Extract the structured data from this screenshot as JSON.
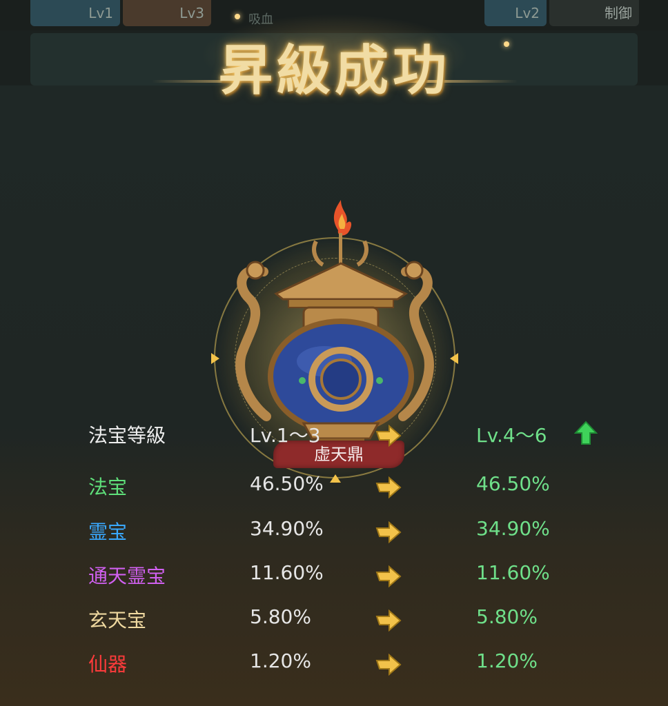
{
  "background_tabs": [
    "Lv1",
    "Lv3",
    "Lv2",
    "制御"
  ],
  "background_fragment": "吸血",
  "banner": {
    "title": "昇級成功"
  },
  "artifact": {
    "name": "虚天鼎"
  },
  "stats": {
    "header": {
      "label": "法宝等級",
      "from": "Lv.1～3",
      "to": "Lv.4～6"
    },
    "rows": [
      {
        "label": "法宝",
        "from": "46.50%",
        "to": "46.50%",
        "color": "#5fe07a"
      },
      {
        "label": "霊宝",
        "from": "34.90%",
        "to": "34.90%",
        "color": "#39a8ff"
      },
      {
        "label": "通天霊宝",
        "from": "11.60%",
        "to": "11.60%",
        "color": "#d060f0"
      },
      {
        "label": "玄天宝",
        "from": "5.80%",
        "to": "5.80%",
        "color": "#f0d9a0"
      },
      {
        "label": "仙器",
        "from": "1.20%",
        "to": "1.20%",
        "color": "#ff3b3b"
      }
    ]
  },
  "colors": {
    "arrow": "#f2c24a",
    "increase": "#6fe08a",
    "up_icon": "#3fd25a"
  }
}
